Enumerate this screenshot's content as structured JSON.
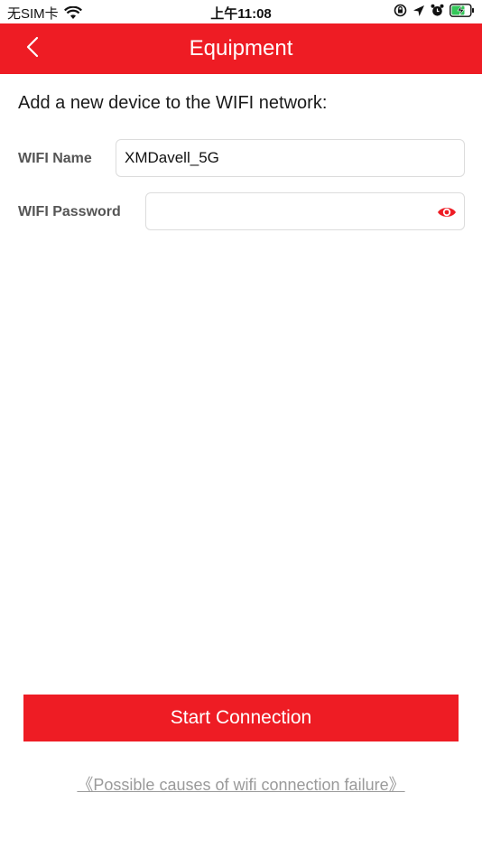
{
  "status_bar": {
    "carrier": "无SIM卡",
    "time": "上午11:08"
  },
  "nav": {
    "title": "Equipment"
  },
  "form": {
    "heading": "Add a new device to the WIFI network:",
    "wifi_name_label": "WIFI Name",
    "wifi_name_value": "XMDavell_5G",
    "wifi_password_label": "WIFI Password",
    "wifi_password_value": ""
  },
  "actions": {
    "start_label": "Start Connection",
    "failure_link": "《Possible causes of wifi connection failure》"
  },
  "icons": {
    "back": "chevron-left-icon",
    "show_password": "eye-icon"
  },
  "colors": {
    "brand": "#ee1c24"
  }
}
